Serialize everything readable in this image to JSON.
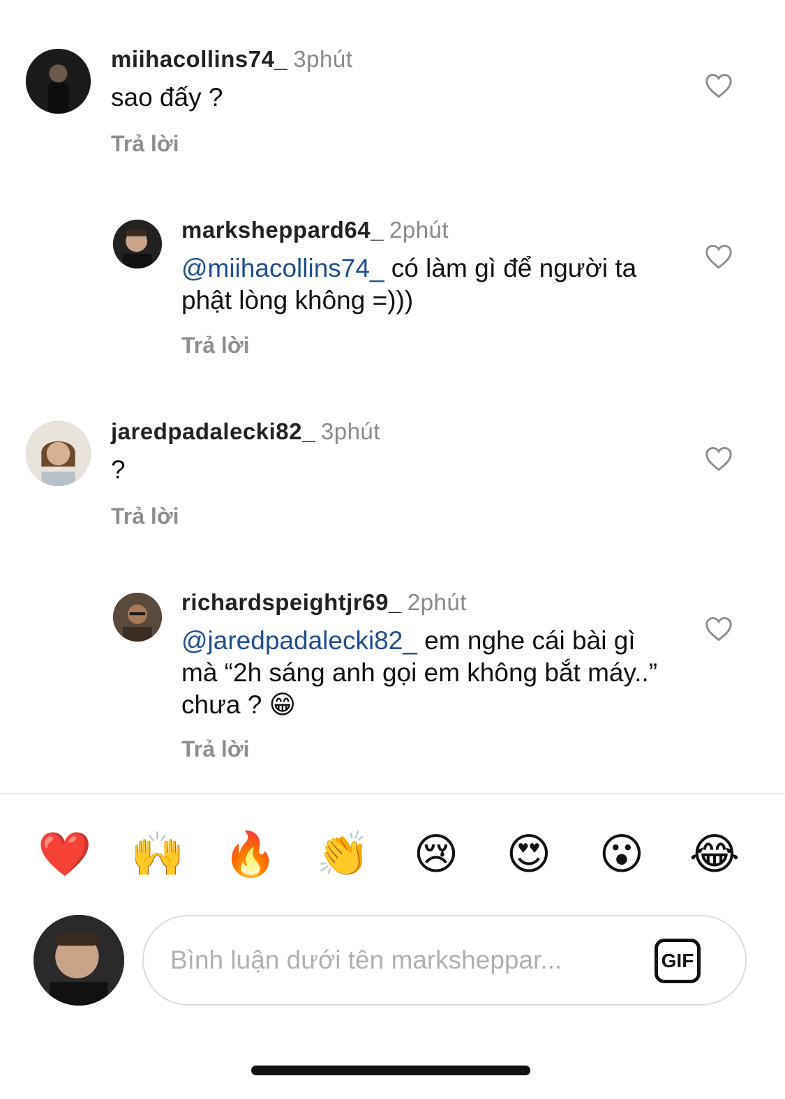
{
  "comments": [
    {
      "username": "miihacollins74_",
      "time": "3phút",
      "mention": "",
      "text": "sao đấy ?",
      "reply_label": "Trả lời",
      "avatar_icon": "user-avatar-icon"
    },
    {
      "username": "marksheppard64_",
      "time": "2phút",
      "mention": "@miihacollins74_",
      "text": " có làm gì để người ta phật lòng không =)))",
      "reply_label": "Trả lời",
      "avatar_icon": "user-avatar-icon"
    },
    {
      "username": "jaredpadalecki82_",
      "time": "3phút",
      "mention": "",
      "text": "?",
      "reply_label": "Trả lời",
      "avatar_icon": "user-avatar-icon"
    },
    {
      "username": "richardspeightjr69_",
      "time": "2phút",
      "mention": "@jaredpadalecki82_",
      "text": " em nghe cái bài gì mà “2h sáng anh gọi em không bắt máy..” chưa ? 😁",
      "reply_label": "Trả lời",
      "avatar_icon": "user-avatar-icon"
    }
  ],
  "reactions": [
    "❤️",
    "🙌",
    "🔥",
    "👏",
    "😢",
    "😍",
    "😮",
    "😂"
  ],
  "composer": {
    "placeholder": "Bình luận dưới tên markshеppar...",
    "gif_label": "GIF"
  },
  "colors": {
    "mention": "#1f4f8a",
    "muted": "#8e8e8e"
  }
}
